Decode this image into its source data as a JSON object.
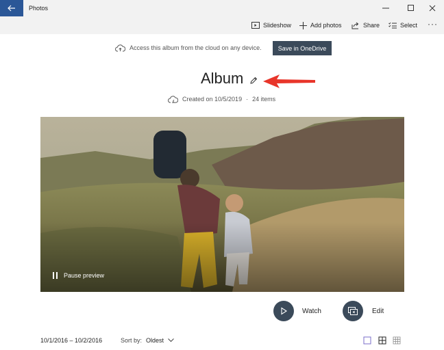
{
  "window": {
    "title": "Photos",
    "icons": {
      "back": "back-arrow-icon",
      "minimize": "minimize-icon",
      "maximize": "maximize-icon",
      "close": "close-icon"
    }
  },
  "toolbar": {
    "slideshow_label": "Slideshow",
    "add_photos_label": "Add photos",
    "share_label": "Share",
    "select_label": "Select",
    "more_label": "···"
  },
  "cloud": {
    "notice": "Access this album from the cloud on any device.",
    "button_label": "Save in OneDrive"
  },
  "album": {
    "title": "Album",
    "created": "Created on 10/5/2019",
    "separator": "·",
    "count": "24 items"
  },
  "preview": {
    "pause_label": "Pause preview"
  },
  "actions": {
    "watch_label": "Watch",
    "edit_label": "Edit"
  },
  "footer": {
    "date_range": "10/1/2016 – 10/2/2016",
    "sort_label": "Sort by:",
    "sort_value": "Oldest"
  },
  "colors": {
    "accent": "#2b5797",
    "button_dark": "#3b4a5a",
    "annotation_red": "#e8352a",
    "chrome": "#f2f2f2"
  }
}
